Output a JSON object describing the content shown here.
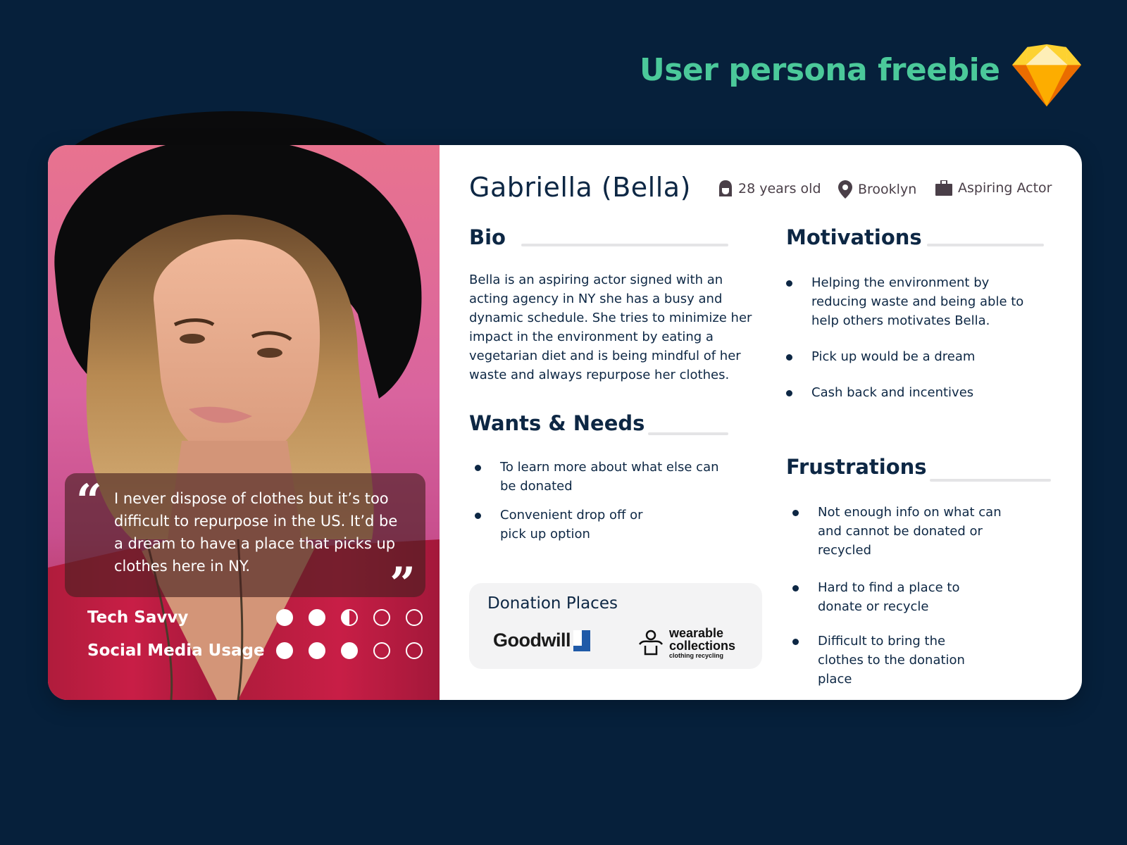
{
  "header": {
    "title": "User persona freebie",
    "logo_icon": "sketch-diamond-icon"
  },
  "persona": {
    "name": "Gabriella (Bella)",
    "meta": [
      {
        "icon": "woman-face-icon",
        "label": "28 years old"
      },
      {
        "icon": "location-pin-icon",
        "label": "Brooklyn"
      },
      {
        "icon": "briefcase-icon",
        "label": "Aspiring Actor"
      }
    ],
    "quote": "I never dispose of clothes but it’s too difficult to repurpose in the US. It’d be a dream to have a place that picks up clothes here in NY.",
    "quote_open_glyph": "“",
    "quote_close_glyph": "”",
    "ratings": [
      {
        "label": "Tech Savvy",
        "value": 2.5,
        "max": 5
      },
      {
        "label": "Social Media Usage",
        "value": 3,
        "max": 5
      }
    ]
  },
  "sections": {
    "bio": {
      "title": "Bio",
      "text": "Bella is an aspiring actor signed with an acting agency in NY she has a busy and dynamic schedule. She tries to minimize her impact in the environment by eating a vegetarian diet and is being mindful of her waste and always repurpose her clothes."
    },
    "wants_needs": {
      "title": "Wants & Needs",
      "items": [
        "To learn more about what else can be donated",
        "Convenient drop off or pick up option"
      ]
    },
    "motivations": {
      "title": "Motivations",
      "items": [
        "Helping the environment by reducing waste and being able to help others motivates Bella.",
        "Pick up would be a dream",
        "Cash back and incentives"
      ]
    },
    "frustrations": {
      "title": "Frustrations",
      "items": [
        "Not enough info on what can and cannot be donated or recycled",
        "Hard to find a place to donate or recycle",
        "Difficult to bring the clothes to the donation place"
      ]
    },
    "donation_places": {
      "title": "Donation Places",
      "logos": [
        {
          "name": "Goodwill"
        },
        {
          "name": "wearable",
          "line2": "collections",
          "tagline": "clothing recycling"
        }
      ]
    }
  },
  "colors": {
    "background": "#06203b",
    "accent_green": "#4bc99a",
    "navy_text": "#0d2744",
    "meta_text": "#4a3f48",
    "card": "#ffffff",
    "donation_box": "#f3f3f4"
  }
}
